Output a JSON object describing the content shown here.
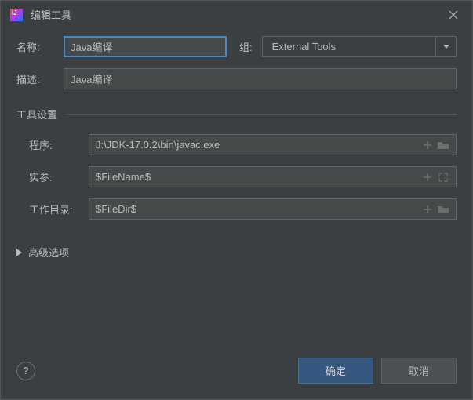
{
  "window": {
    "title": "编辑工具"
  },
  "form": {
    "name_label": "名称:",
    "name_value": "Java编译",
    "group_label": "组:",
    "group_value": "External Tools",
    "desc_label": "描述:",
    "desc_value": "Java编译"
  },
  "toolSettings": {
    "section_title": "工具设置",
    "program_label": "程序:",
    "program_value": "J:\\JDK-17.0.2\\bin\\javac.exe",
    "args_label": "实参:",
    "args_value": "$FileName$",
    "workdir_label": "工作目录:",
    "workdir_value": "$FileDir$"
  },
  "advanced": {
    "label": "高级选项"
  },
  "buttons": {
    "ok": "确定",
    "cancel": "取消"
  }
}
